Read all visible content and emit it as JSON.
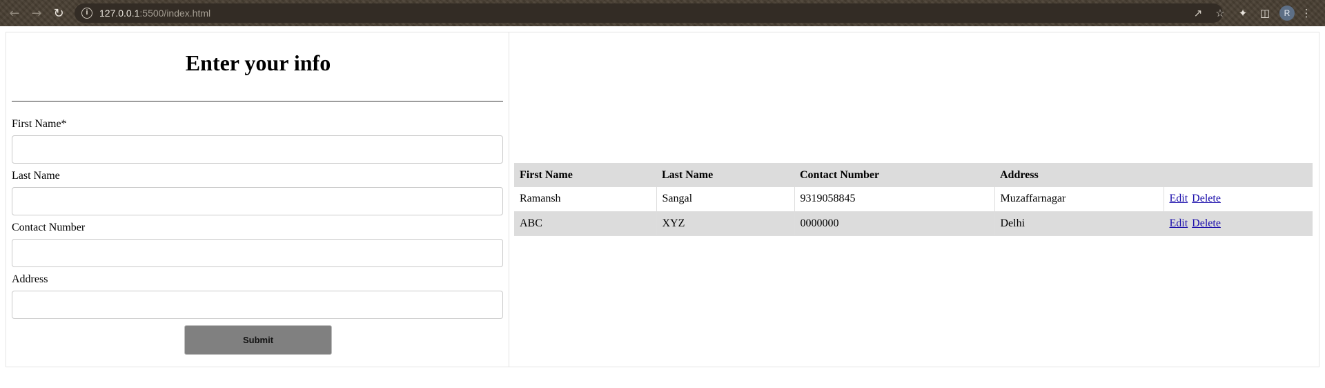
{
  "browser": {
    "url_host": "127.0.0.1",
    "url_rest": ":5500/index.html",
    "profile_initial": "R",
    "icons": {
      "back": "arrow-left-icon",
      "forward": "arrow-right-icon",
      "reload": "reload-icon",
      "info": "info-icon",
      "share": "share-icon",
      "bookmark": "star-icon",
      "extensions": "puzzle-icon",
      "side_panel": "side-panel-icon",
      "menu": "kebab-menu-icon"
    }
  },
  "form": {
    "title": "Enter your info",
    "fields": [
      {
        "label": "First Name*",
        "value": "",
        "placeholder": ""
      },
      {
        "label": "Last Name",
        "value": "",
        "placeholder": ""
      },
      {
        "label": "Contact Number",
        "value": "",
        "placeholder": ""
      },
      {
        "label": "Address",
        "value": "",
        "placeholder": ""
      }
    ],
    "submit_label": "Submit"
  },
  "table": {
    "headers": [
      "First Name",
      "Last Name",
      "Contact Number",
      "Address",
      ""
    ],
    "rows": [
      {
        "first_name": "Ramansh",
        "last_name": "Sangal",
        "contact": "9319058845",
        "address": "Muzaffarnagar",
        "edit": "Edit",
        "delete": "Delete"
      },
      {
        "first_name": "ABC",
        "last_name": "XYZ",
        "contact": "0000000",
        "address": "Delhi",
        "edit": "Edit",
        "delete": "Delete"
      }
    ]
  },
  "colors": {
    "header_bg": "#dcdcdc",
    "submit_bg": "#808080",
    "link": "#1a0dab"
  }
}
